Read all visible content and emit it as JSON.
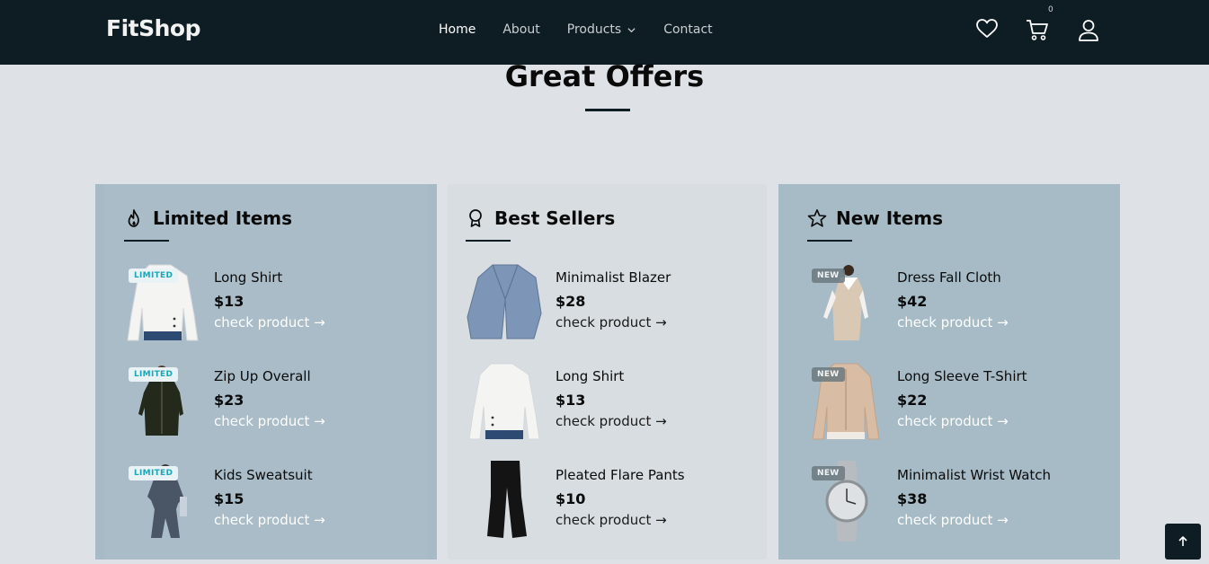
{
  "brand": "FitShop",
  "nav": {
    "items": [
      "Home",
      "About",
      "Products",
      "Contact"
    ],
    "cart_count": "0"
  },
  "section_title": "Great Offers",
  "cards": [
    {
      "title": "Limited Items",
      "icon": "flame-icon",
      "items": [
        {
          "name": "Long Shirt",
          "price": "$13",
          "link": "check product →",
          "badge": "LIMITED"
        },
        {
          "name": "Zip Up Overall",
          "price": "$23",
          "link": "check product →",
          "badge": "LIMITED"
        },
        {
          "name": "Kids Sweatsuit",
          "price": "$15",
          "link": "check product →",
          "badge": "LIMITED"
        }
      ]
    },
    {
      "title": "Best Sellers",
      "icon": "award-icon",
      "items": [
        {
          "name": "Minimalist Blazer",
          "price": "$28",
          "link": "check product →"
        },
        {
          "name": "Long Shirt",
          "price": "$13",
          "link": "check product →"
        },
        {
          "name": "Pleated Flare Pants",
          "price": "$10",
          "link": "check product →"
        }
      ]
    },
    {
      "title": "New Items",
      "icon": "star-icon",
      "items": [
        {
          "name": "Dress Fall Cloth",
          "price": "$42",
          "link": "check product →",
          "badge": "NEW"
        },
        {
          "name": "Long Sleeve T-Shirt",
          "price": "$22",
          "link": "check product →",
          "badge": "NEW"
        },
        {
          "name": "Minimalist Wrist Watch",
          "price": "$38",
          "link": "check product →",
          "badge": "NEW"
        }
      ]
    }
  ],
  "colors": {
    "navbar": "#0e1d24",
    "page_bg": "#dee2e6",
    "card_blue": "#a7bbc7",
    "card_grey": "#d7dde1",
    "limited_badge_text": "#1aa5b8"
  }
}
